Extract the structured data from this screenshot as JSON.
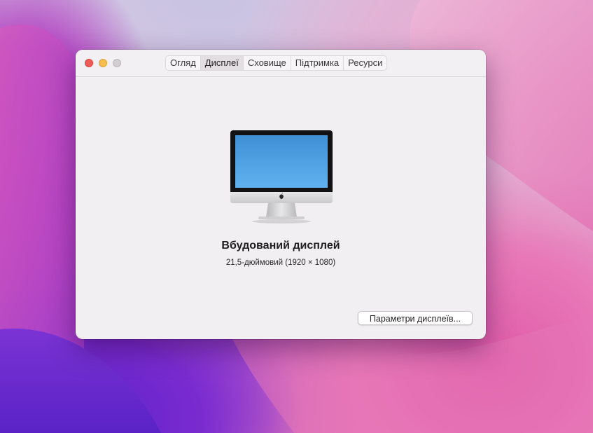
{
  "window": {
    "tabs": [
      {
        "label": "Огляд",
        "active": false
      },
      {
        "label": "Дисплеї",
        "active": true
      },
      {
        "label": "Сховище",
        "active": false
      },
      {
        "label": "Підтримка",
        "active": false
      },
      {
        "label": "Ресурси",
        "active": false
      }
    ]
  },
  "display": {
    "icon": "imac-icon",
    "name": "Вбудований дисплей",
    "description": "21,5-дюймовий (1920 × 1080)"
  },
  "actions": {
    "display_settings_label": "Параметри дисплеїв..."
  },
  "colors": {
    "close": "#ee5c57",
    "minimize": "#f5be4f",
    "zoom_inactive": "#d2ced2",
    "screen_blue": "#4aa0e6"
  }
}
